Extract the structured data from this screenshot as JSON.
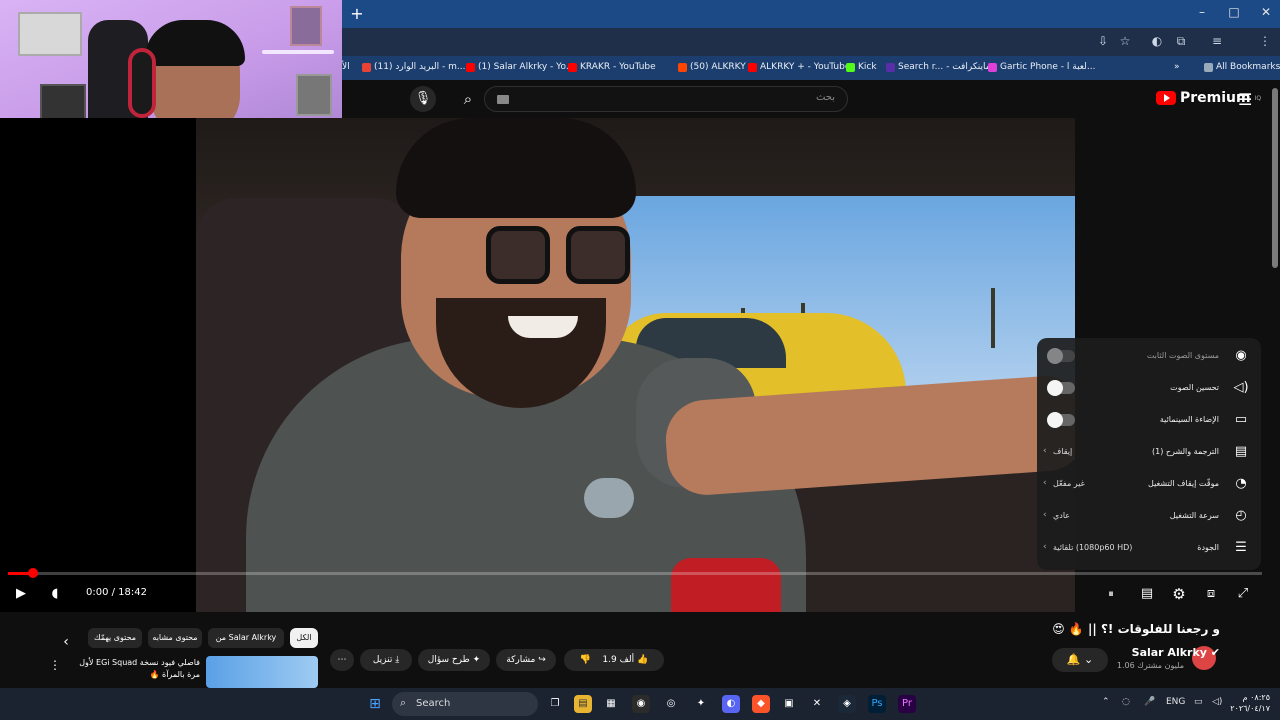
{
  "browser": {
    "new_tab_label": "+",
    "window_controls": {
      "minimize": "–",
      "maximize": "□",
      "close": "✕"
    },
    "address_icons": [
      "⇩",
      "☆",
      "◐",
      "⧉",
      "≡",
      "⋮"
    ],
    "bookmarks": [
      {
        "label": "الأ",
        "color": "#888888"
      },
      {
        "label": "(11) البريد الوارد - m...",
        "color": "#ea4335"
      },
      {
        "label": "(1) Salar Alkrky - Yo...",
        "color": "#ff0000"
      },
      {
        "label": "KRAKR - YouTube",
        "color": "#ff0000"
      },
      {
        "label": "(50) ALKRKY",
        "color": "#ff4500"
      },
      {
        "label": "ALKRKY + - YouTube",
        "color": "#ff0000"
      },
      {
        "label": "Kick",
        "color": "#53fc18"
      },
      {
        "label": "Search r... - ماينكرافت",
        "color": "#5a2ea6"
      },
      {
        "label": "Gartic Phone - لعبة ا...",
        "color": "#e03fd8"
      }
    ],
    "bookmarks_more": "»",
    "all_bookmarks": "All Bookmarks"
  },
  "youtube": {
    "logo_text": "Premium",
    "logo_sup": "IQ",
    "search_placeholder": "بحث",
    "search_icon": "search-icon",
    "mic_icon": "microphone-icon",
    "menu_icon": "☰"
  },
  "settings_menu": {
    "rows": [
      {
        "label": "مستوى الصوت الثابت",
        "value": "",
        "type": "toggle-dim",
        "icon": "◉"
      },
      {
        "label": "تحسين الصوت",
        "value": "",
        "type": "toggle",
        "icon": "◁)"
      },
      {
        "label": "الإضاءة السينمائية",
        "value": "",
        "type": "toggle",
        "icon": "▭"
      },
      {
        "label": "الترجمة والشرح (1)",
        "value": "إيقاف",
        "type": "value",
        "icon": "▤"
      },
      {
        "label": "موقّت إيقاف التشغيل",
        "value": "غير مفعّل",
        "type": "value",
        "icon": "◔"
      },
      {
        "label": "سرعة التشغيل",
        "value": "عادي",
        "type": "value",
        "icon": "◴"
      },
      {
        "label": "الجودة",
        "value": "تلقائية (1080p60 HD)",
        "type": "value",
        "icon": "☰"
      }
    ]
  },
  "player": {
    "current_time": "0:00",
    "duration": "18:42",
    "time_display": "0:00 / 18:42",
    "progress": 0.02,
    "buffered": 0.02,
    "play_icon": "▶",
    "volume_icon": "◖",
    "autoplay_icon": "⏸",
    "subtitles_icon": "▤",
    "settings_icon": "⚙",
    "miniplayer_icon": "⧈",
    "fullscreen_icon": "⤢"
  },
  "video_info": {
    "title": "و رجعنا للفلوقات !؟ || 🔥 😍",
    "channel_name": "Salar Alkrky",
    "subscribers": "1.06 مليون مشترك",
    "notify_icon": "🔔",
    "like_count": "1.9 ألف",
    "share_label": "مشاركة",
    "ask_label": "طرح سؤال",
    "download_label": "تنزيل",
    "more_label": "⋯"
  },
  "recommendations": {
    "chips": [
      {
        "label": "الكل",
        "active": true
      },
      {
        "label": "من Salar Alkrky",
        "active": false
      },
      {
        "label": "محتوى مشابه",
        "active": false
      },
      {
        "label": "محتوى يهمّك",
        "active": false
      }
    ],
    "first_item_title": "فاصلي فيود نسخة EGi Squad لأول مرة بالمرآة 🔥"
  },
  "taskbar": {
    "search_label": "Search",
    "language": "ENG",
    "time": "٠٨:٢٥ م",
    "date": "٢٠٢٦/٠٤/١٧",
    "apps": [
      "⊞",
      "❐",
      "▤",
      "▦",
      "◉",
      "◎",
      "✦",
      "◐",
      "◆",
      "▣",
      "✎",
      "✕",
      "◈",
      "Ps",
      "Pr"
    ]
  }
}
